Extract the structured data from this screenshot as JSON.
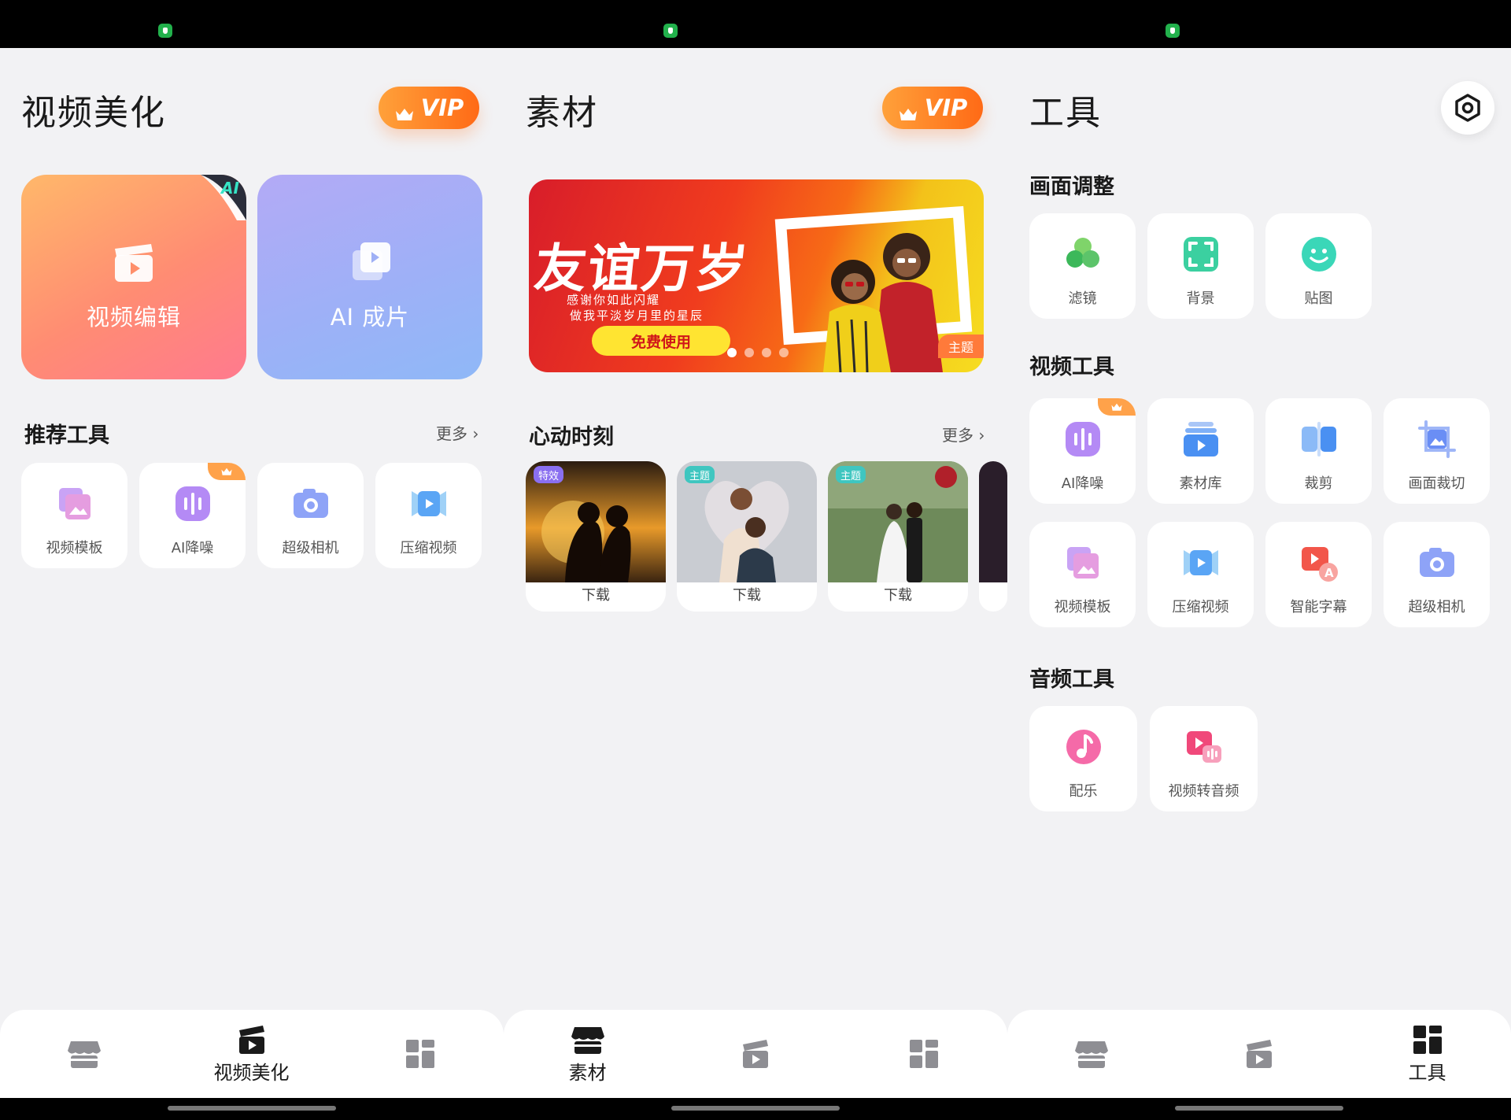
{
  "panels": {
    "beautify": {
      "title": "视频美化",
      "vip_label": "VIP",
      "cards": [
        {
          "label": "视频编辑",
          "badge": "AI"
        },
        {
          "label": "AI 成片"
        }
      ],
      "recommend": {
        "heading": "推荐工具",
        "more": "更多",
        "tools": [
          {
            "label": "视频模板",
            "icon": "template-icon"
          },
          {
            "label": "AI降噪",
            "icon": "ai-denoise-icon",
            "vip": true
          },
          {
            "label": "超级相机",
            "icon": "camera-icon"
          },
          {
            "label": "压缩视频",
            "icon": "compress-icon"
          }
        ]
      },
      "nav_active_label": "视频美化"
    },
    "materials": {
      "title": "素材",
      "vip_label": "VIP",
      "banner": {
        "title": "友谊万岁",
        "sub1": "感谢你如此闪耀",
        "sub2": "做我平淡岁月里的星辰",
        "button": "免费使用",
        "tag": "主题",
        "slides": 4,
        "active_slide": 0
      },
      "moments": {
        "heading": "心动时刻",
        "more": "更多",
        "items": [
          {
            "tag": "特效",
            "label": "下载"
          },
          {
            "tag": "主题",
            "label": "下载"
          },
          {
            "tag": "主题",
            "label": "下载"
          }
        ]
      },
      "nav_active_label": "素材"
    },
    "tools": {
      "title": "工具",
      "sections": [
        {
          "heading": "画面调整",
          "tools": [
            {
              "label": "滤镜",
              "icon": "filter-icon"
            },
            {
              "label": "背景",
              "icon": "background-icon"
            },
            {
              "label": "贴图",
              "icon": "sticker-icon"
            }
          ]
        },
        {
          "heading": "视频工具",
          "tools": [
            {
              "label": "AI降噪",
              "icon": "ai-denoise-icon",
              "vip": true
            },
            {
              "label": "素材库",
              "icon": "library-icon"
            },
            {
              "label": "裁剪",
              "icon": "trim-icon"
            },
            {
              "label": "画面裁切",
              "icon": "crop-icon"
            },
            {
              "label": "视频模板",
              "icon": "template-icon"
            },
            {
              "label": "压缩视频",
              "icon": "compress-icon"
            },
            {
              "label": "智能字幕",
              "icon": "subtitle-icon"
            },
            {
              "label": "超级相机",
              "icon": "camera-icon"
            }
          ]
        },
        {
          "heading": "音频工具",
          "tools": [
            {
              "label": "配乐",
              "icon": "music-icon"
            },
            {
              "label": "视频转音频",
              "icon": "video-to-audio-icon"
            }
          ]
        }
      ],
      "nav_active_label": "工具"
    }
  },
  "colors": {
    "vip_orange": "#ff7a1e",
    "background": "#f2f2f4",
    "nav_icon_inactive": "#8e8e93",
    "nav_icon_active": "#1a1a1a"
  }
}
